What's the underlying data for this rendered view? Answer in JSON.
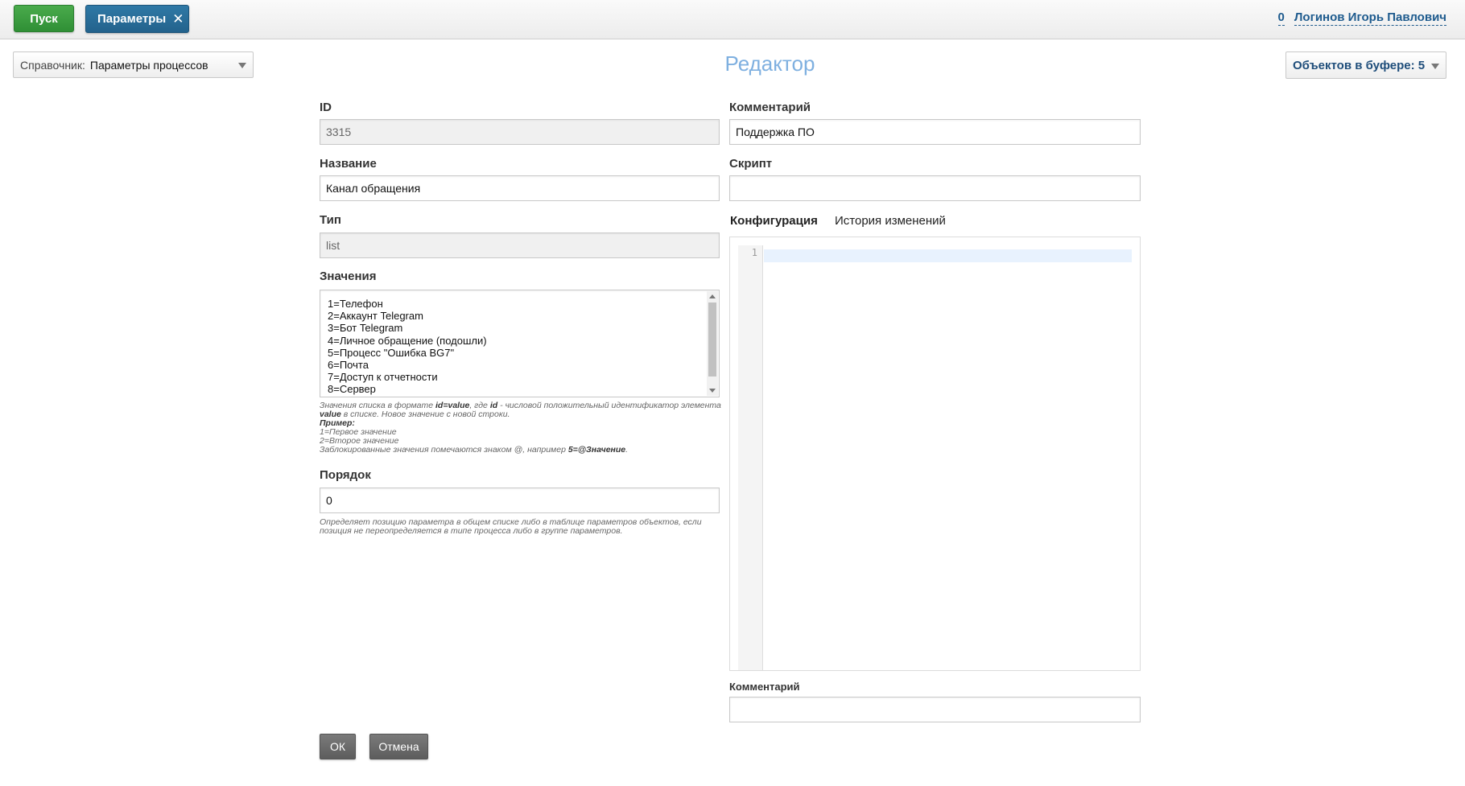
{
  "topbar": {
    "start_label": "Пуск",
    "tab_label": "Параметры",
    "tab_close": "✕",
    "counter": "0",
    "user_name": "Логинов Игорь Павлович"
  },
  "toolbar": {
    "dict_label": "Справочник:",
    "dict_value": "Параметры процессов",
    "title": "Редактор",
    "buffer_label": "Объектов в буфере: 5"
  },
  "form": {
    "id_label": "ID",
    "id_value": "3315",
    "name_label": "Название",
    "name_value": "Канал обращения",
    "type_label": "Тип",
    "type_value": "list",
    "values_label": "Значения",
    "values_items": [
      "1=Телефон",
      "2=Аккаунт Telegram",
      "3=Бот Telegram",
      "4=Личное обращение (подошли)",
      "5=Процесс \"Ошибка BG7\"",
      "6=Почта",
      "7=Доступ к отчетности",
      "8=Сервер"
    ],
    "values_hint": {
      "l1a": "Значения списка в формате ",
      "l1b": "id=value",
      "l1c": ", где ",
      "l1d": "id",
      "l1e": " - числовой положительный идентификатор элемента",
      "l2a": "value",
      "l2b": " в списке. Новое значение с новой строки.",
      "l3": "Пример:",
      "l4": "1=Первое значение",
      "l5": "2=Второе значение",
      "l6a": "Заблокированные значения помечаются знаком @, например ",
      "l6b": "5=@Значение",
      "l6c": "."
    },
    "order_label": "Порядок",
    "order_value": "0",
    "order_hint_1": "Определяет позицию параметра в общем списке либо в таблице параметров объектов, если",
    "order_hint_2": "позиция не переопределяется в типе процесса либо в группе параметров.",
    "comment_label": "Комментарий",
    "comment_value": "Поддержка ПО",
    "script_label": "Скрипт",
    "script_value": "",
    "tab_config": "Конфигурация",
    "tab_history": "История изменений",
    "editor_line_number": "1",
    "bottom_comment_label": "Комментарий",
    "bottom_comment_value": "",
    "ok_label": "ОК",
    "cancel_label": "Отмена"
  },
  "colors": {
    "start_button": "#3a9a3f",
    "tab_active": "#2a6e9b",
    "title": "#7fb0e0",
    "link": "#1e5b8e"
  }
}
